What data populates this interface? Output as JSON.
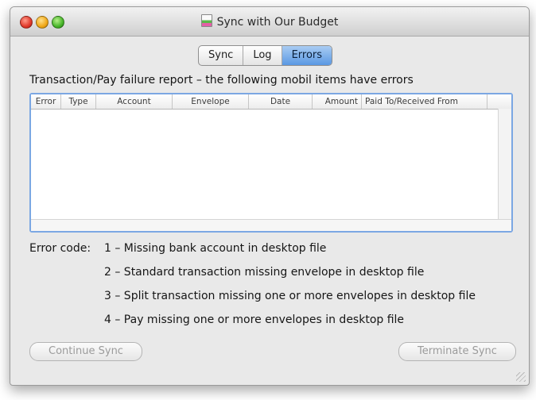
{
  "window": {
    "title": "Sync with Our Budget"
  },
  "tabs": [
    {
      "label": "Sync",
      "selected": false
    },
    {
      "label": "Log",
      "selected": false
    },
    {
      "label": "Errors",
      "selected": true
    }
  ],
  "report": {
    "heading": "Transaction/Pay failure report – the following mobil items have errors",
    "columns": [
      "Error",
      "Type",
      "Account",
      "Envelope",
      "Date",
      "Amount",
      "Paid To/Received From"
    ],
    "rows": []
  },
  "error_codes": {
    "label": "Error code:",
    "lines": [
      "1 – Missing bank account in desktop file",
      "2 – Standard transaction missing envelope in desktop file",
      "3 – Split transaction missing one or more envelopes in desktop file",
      "4 – Pay missing one or more envelopes in desktop file"
    ]
  },
  "buttons": {
    "continue": "Continue Sync",
    "terminate": "Terminate Sync"
  },
  "colors": {
    "selected_tab": "#5a98e3",
    "table_focus_ring": "#7ba7e3",
    "window_bg": "#e9e9e9"
  }
}
